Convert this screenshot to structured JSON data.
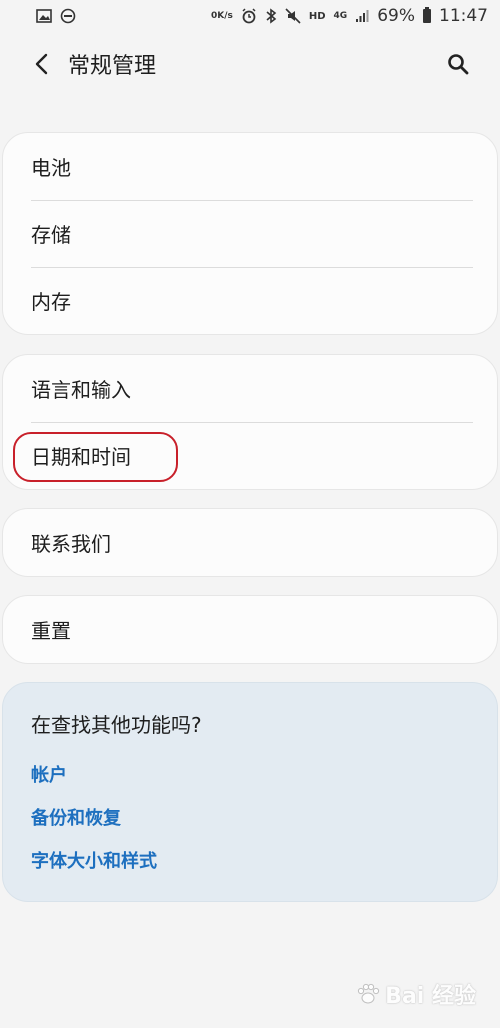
{
  "status_bar": {
    "net_speed_value": "0",
    "net_speed_unit": "K/s",
    "hd": "HD",
    "network": "4G",
    "battery": "69%",
    "time": "11:47",
    "icons": [
      "image-icon",
      "do-not-disturb-icon",
      "alarm-icon",
      "bluetooth-icon",
      "mute-icon",
      "signal-icon",
      "battery-icon"
    ]
  },
  "header": {
    "title": "常规管理",
    "back_icon": "back-arrow-icon",
    "search_icon": "search-icon"
  },
  "groups": [
    {
      "items": [
        {
          "label": "电池"
        },
        {
          "label": "存储"
        },
        {
          "label": "内存"
        }
      ]
    },
    {
      "items": [
        {
          "label": "语言和输入"
        },
        {
          "label": "日期和时间"
        }
      ]
    },
    {
      "items": [
        {
          "label": "联系我们"
        }
      ]
    },
    {
      "items": [
        {
          "label": "重置"
        }
      ]
    }
  ],
  "highlighted_item": "日期和时间",
  "highlight_color": "#c8202a",
  "suggestions": {
    "title": "在查找其他功能吗?",
    "links": [
      {
        "label": "帐户"
      },
      {
        "label": "备份和恢复"
      },
      {
        "label": "字体大小和样式"
      }
    ],
    "link_color": "#1d6fbf"
  },
  "watermark": {
    "text": "Bai  经验"
  }
}
